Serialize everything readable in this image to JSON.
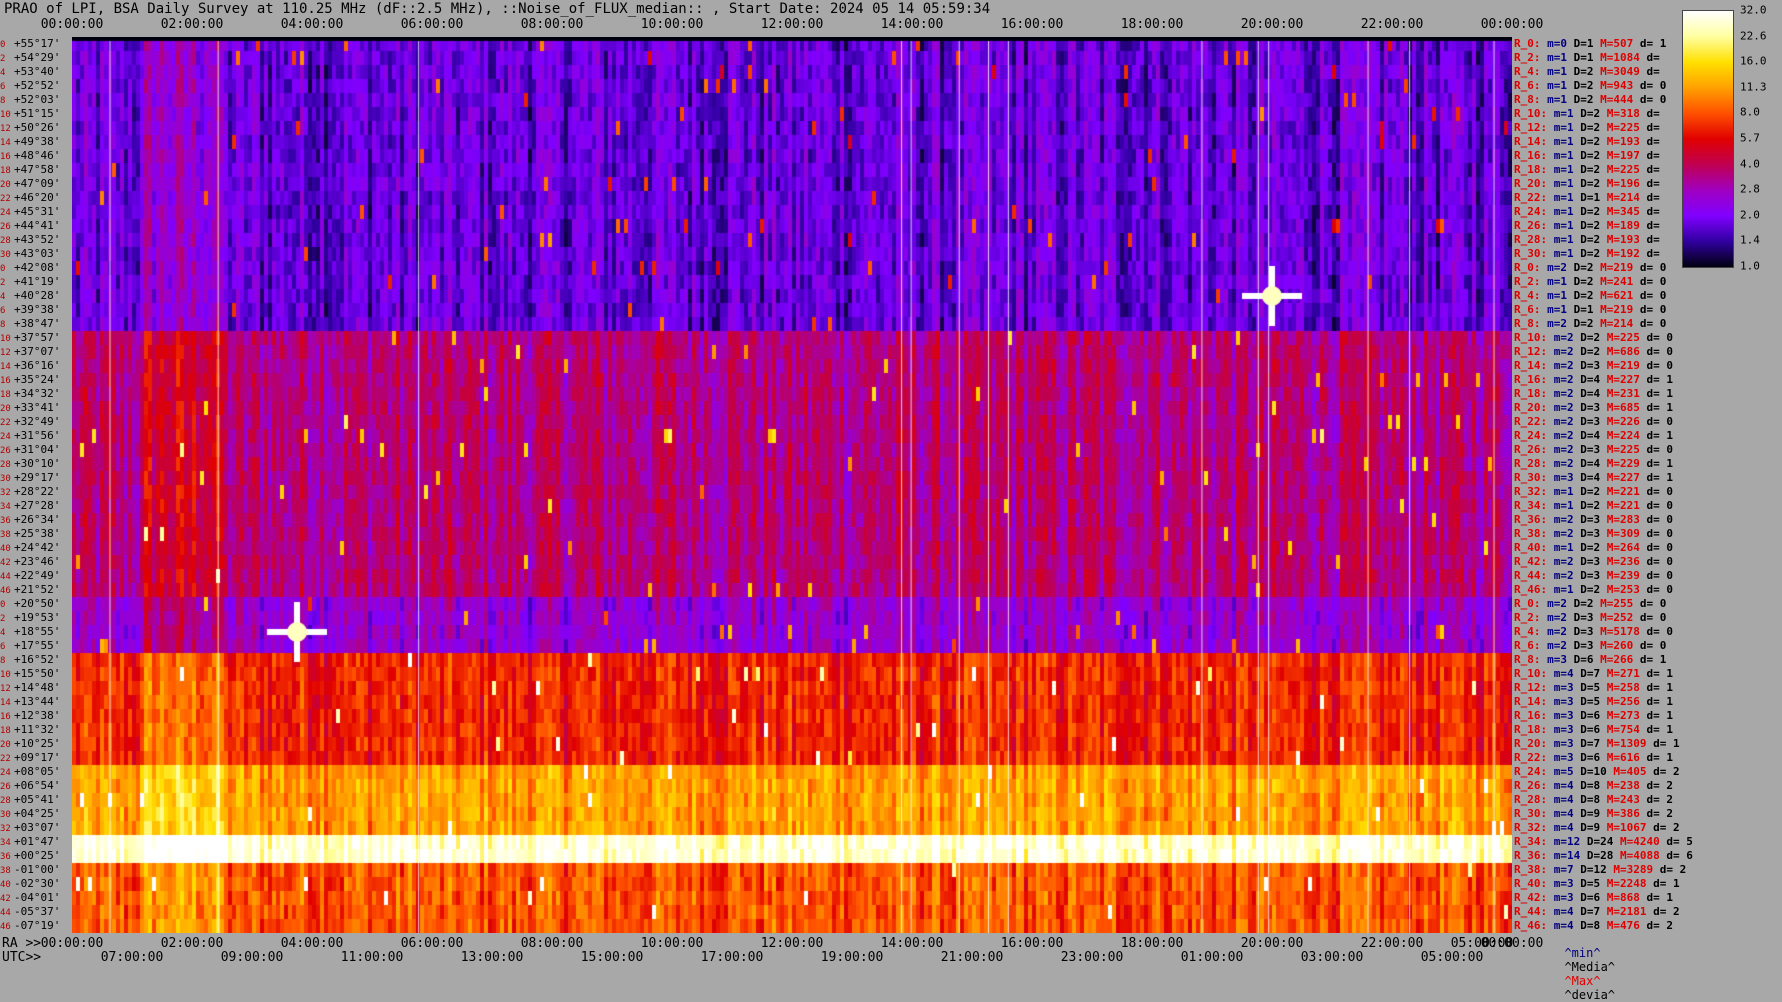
{
  "title": "PRAO of LPI, BSA Daily Survey at 110.25 MHz (dF::2.5 MHz), ::Noise_of_FLUX_median:: , Start Date: 2024 05 14 05:59:34",
  "axis": {
    "top_ticks": [
      "00:00:00",
      "02:00:00",
      "04:00:00",
      "06:00:00",
      "08:00:00",
      "10:00:00",
      "12:00:00",
      "14:00:00",
      "16:00:00",
      "18:00:00",
      "20:00:00",
      "22:00:00",
      "00:00:00"
    ],
    "ra_prefix": "RA >>",
    "ra_ticks": [
      "00:00:00",
      "02:00:00",
      "04:00:00",
      "06:00:00",
      "08:00:00",
      "10:00:00",
      "12:00:00",
      "14:00:00",
      "16:00:00",
      "18:00:00",
      "20:00:00",
      "22:00:00",
      "05:00:00",
      "00:00:00"
    ],
    "utc_prefix": "UTC>>",
    "utc_ticks": [
      "07:00:00",
      "09:00:00",
      "11:00:00",
      "13:00:00",
      "15:00:00",
      "17:00:00",
      "19:00:00",
      "21:00:00",
      "23:00:00",
      "01:00:00",
      "03:00:00",
      "05:00:00"
    ]
  },
  "colorbar": {
    "ticks": [
      "32.0",
      "22.6",
      "16.0",
      "11.3",
      "8.0",
      "5.7",
      "4.0",
      "2.8",
      "2.0",
      "1.4",
      "1.0"
    ],
    "colors": [
      "#ffffff",
      "#ffffa0",
      "#ffe000",
      "#ffa000",
      "#ff5000",
      "#e00000",
      "#c00050",
      "#a000c0",
      "#8000ff",
      "#3000a0",
      "#000010"
    ]
  },
  "legend_key": {
    "min": "^min^",
    "median": "^Media^",
    "max": "^Max^",
    "devia": "^devia^",
    "min_color": "#000080",
    "median_color": "#000000",
    "max_color": "#e00000",
    "devia_color": "#000000"
  },
  "rows": [
    {
      "idx": "0",
      "dec": "+55°17'",
      "r": "R_0:",
      "m": "m=0",
      "D": "D=1",
      "M": "M=507",
      "d": "d= 1"
    },
    {
      "idx": "2",
      "dec": "+54°29'",
      "r": "R_2:",
      "m": "m=1",
      "D": "D=1",
      "M": "M=1084",
      "d": "d="
    },
    {
      "idx": "4",
      "dec": "+53°40'",
      "r": "R_4:",
      "m": "m=1",
      "D": "D=2",
      "M": "M=3049",
      "d": "d="
    },
    {
      "idx": "6",
      "dec": "+52°52'",
      "r": "R_6:",
      "m": "m=1",
      "D": "D=2",
      "M": "M=943",
      "d": "d= 0"
    },
    {
      "idx": "8",
      "dec": "+52°03'",
      "r": "R_8:",
      "m": "m=1",
      "D": "D=2",
      "M": "M=444",
      "d": "d= 0"
    },
    {
      "idx": "10",
      "dec": "+51°15'",
      "r": "R_10:",
      "m": "m=1",
      "D": "D=2",
      "M": "M=318",
      "d": "d="
    },
    {
      "idx": "12",
      "dec": "+50°26'",
      "r": "R_12:",
      "m": "m=1",
      "D": "D=2",
      "M": "M=225",
      "d": "d="
    },
    {
      "idx": "14",
      "dec": "+49°38'",
      "r": "R_14:",
      "m": "m=1",
      "D": "D=2",
      "M": "M=193",
      "d": "d="
    },
    {
      "idx": "16",
      "dec": "+48°46'",
      "r": "R_16:",
      "m": "m=1",
      "D": "D=2",
      "M": "M=197",
      "d": "d="
    },
    {
      "idx": "18",
      "dec": "+47°58'",
      "r": "R_18:",
      "m": "m=1",
      "D": "D=2",
      "M": "M=225",
      "d": "d="
    },
    {
      "idx": "20",
      "dec": "+47°09'",
      "r": "R_20:",
      "m": "m=1",
      "D": "D=2",
      "M": "M=196",
      "d": "d="
    },
    {
      "idx": "22",
      "dec": "+46°20'",
      "r": "R_22:",
      "m": "m=1",
      "D": "D=1",
      "M": "M=214",
      "d": "d="
    },
    {
      "idx": "24",
      "dec": "+45°31'",
      "r": "R_24:",
      "m": "m=1",
      "D": "D=2",
      "M": "M=345",
      "d": "d="
    },
    {
      "idx": "26",
      "dec": "+44°41'",
      "r": "R_26:",
      "m": "m=1",
      "D": "D=2",
      "M": "M=189",
      "d": "d="
    },
    {
      "idx": "28",
      "dec": "+43°52'",
      "r": "R_28:",
      "m": "m=1",
      "D": "D=2",
      "M": "M=193",
      "d": "d="
    },
    {
      "idx": "30",
      "dec": "+43°03'",
      "r": "R_30:",
      "m": "m=1",
      "D": "D=2",
      "M": "M=192",
      "d": "d="
    },
    {
      "idx": "0",
      "dec": "+42°08'",
      "r": "R_0:",
      "m": "m=2",
      "D": "D=2",
      "M": "M=219",
      "d": "d= 0"
    },
    {
      "idx": "2",
      "dec": "+41°19'",
      "r": "R_2:",
      "m": "m=1",
      "D": "D=2",
      "M": "M=241",
      "d": "d= 0"
    },
    {
      "idx": "4",
      "dec": "+40°28'",
      "r": "R_4:",
      "m": "m=1",
      "D": "D=2",
      "M": "M=621",
      "d": "d= 0"
    },
    {
      "idx": "6",
      "dec": "+39°38'",
      "r": "R_6:",
      "m": "m=1",
      "D": "D=1",
      "M": "M=219",
      "d": "d= 0"
    },
    {
      "idx": "8",
      "dec": "+38°47'",
      "r": "R_8:",
      "m": "m=2",
      "D": "D=2",
      "M": "M=214",
      "d": "d= 0"
    },
    {
      "idx": "10",
      "dec": "+37°57'",
      "r": "R_10:",
      "m": "m=2",
      "D": "D=2",
      "M": "M=225",
      "d": "d= 0"
    },
    {
      "idx": "12",
      "dec": "+37°07'",
      "r": "R_12:",
      "m": "m=2",
      "D": "D=2",
      "M": "M=686",
      "d": "d= 0"
    },
    {
      "idx": "14",
      "dec": "+36°16'",
      "r": "R_14:",
      "m": "m=2",
      "D": "D=3",
      "M": "M=219",
      "d": "d= 0"
    },
    {
      "idx": "16",
      "dec": "+35°24'",
      "r": "R_16:",
      "m": "m=2",
      "D": "D=4",
      "M": "M=227",
      "d": "d= 1"
    },
    {
      "idx": "18",
      "dec": "+34°32'",
      "r": "R_18:",
      "m": "m=2",
      "D": "D=4",
      "M": "M=231",
      "d": "d= 1"
    },
    {
      "idx": "20",
      "dec": "+33°41'",
      "r": "R_20:",
      "m": "m=2",
      "D": "D=3",
      "M": "M=685",
      "d": "d= 1"
    },
    {
      "idx": "22",
      "dec": "+32°49'",
      "r": "R_22:",
      "m": "m=2",
      "D": "D=3",
      "M": "M=226",
      "d": "d= 0"
    },
    {
      "idx": "24",
      "dec": "+31°56'",
      "r": "R_24:",
      "m": "m=2",
      "D": "D=4",
      "M": "M=224",
      "d": "d= 1"
    },
    {
      "idx": "26",
      "dec": "+31°04'",
      "r": "R_26:",
      "m": "m=2",
      "D": "D=3",
      "M": "M=225",
      "d": "d= 0"
    },
    {
      "idx": "28",
      "dec": "+30°10'",
      "r": "R_28:",
      "m": "m=2",
      "D": "D=4",
      "M": "M=229",
      "d": "d= 1"
    },
    {
      "idx": "30",
      "dec": "+29°17'",
      "r": "R_30:",
      "m": "m=3",
      "D": "D=4",
      "M": "M=227",
      "d": "d= 1"
    },
    {
      "idx": "32",
      "dec": "+28°22'",
      "r": "R_32:",
      "m": "m=1",
      "D": "D=2",
      "M": "M=221",
      "d": "d= 0"
    },
    {
      "idx": "34",
      "dec": "+27°28'",
      "r": "R_34:",
      "m": "m=1",
      "D": "D=2",
      "M": "M=221",
      "d": "d= 0"
    },
    {
      "idx": "36",
      "dec": "+26°34'",
      "r": "R_36:",
      "m": "m=2",
      "D": "D=3",
      "M": "M=283",
      "d": "d= 0"
    },
    {
      "idx": "38",
      "dec": "+25°38'",
      "r": "R_38:",
      "m": "m=2",
      "D": "D=3",
      "M": "M=309",
      "d": "d= 0"
    },
    {
      "idx": "40",
      "dec": "+24°42'",
      "r": "R_40:",
      "m": "m=1",
      "D": "D=2",
      "M": "M=264",
      "d": "d= 0"
    },
    {
      "idx": "42",
      "dec": "+23°46'",
      "r": "R_42:",
      "m": "m=2",
      "D": "D=3",
      "M": "M=236",
      "d": "d= 0"
    },
    {
      "idx": "44",
      "dec": "+22°49'",
      "r": "R_44:",
      "m": "m=2",
      "D": "D=3",
      "M": "M=239",
      "d": "d= 0"
    },
    {
      "idx": "46",
      "dec": "+21°52'",
      "r": "R_46:",
      "m": "m=1",
      "D": "D=2",
      "M": "M=253",
      "d": "d= 0"
    },
    {
      "idx": "0",
      "dec": "+20°50'",
      "r": "R_0:",
      "m": "m=2",
      "D": "D=2",
      "M": "M=255",
      "d": "d= 0"
    },
    {
      "idx": "2",
      "dec": "+19°53'",
      "r": "R_2:",
      "m": "m=2",
      "D": "D=3",
      "M": "M=252",
      "d": "d= 0"
    },
    {
      "idx": "4",
      "dec": "+18°55'",
      "r": "R_4:",
      "m": "m=2",
      "D": "D=3",
      "M": "M=5178",
      "d": "d= 0"
    },
    {
      "idx": "6",
      "dec": "+17°55'",
      "r": "R_6:",
      "m": "m=2",
      "D": "D=3",
      "M": "M=260",
      "d": "d= 0"
    },
    {
      "idx": "8",
      "dec": "+16°52'",
      "r": "R_8:",
      "m": "m=3",
      "D": "D=6",
      "M": "M=266",
      "d": "d= 1"
    },
    {
      "idx": "10",
      "dec": "+15°50'",
      "r": "R_10:",
      "m": "m=4",
      "D": "D=7",
      "M": "M=271",
      "d": "d= 1"
    },
    {
      "idx": "12",
      "dec": "+14°48'",
      "r": "R_12:",
      "m": "m=3",
      "D": "D=5",
      "M": "M=258",
      "d": "d= 1"
    },
    {
      "idx": "14",
      "dec": "+13°44'",
      "r": "R_14:",
      "m": "m=3",
      "D": "D=5",
      "M": "M=256",
      "d": "d= 1"
    },
    {
      "idx": "16",
      "dec": "+12°38'",
      "r": "R_16:",
      "m": "m=3",
      "D": "D=6",
      "M": "M=273",
      "d": "d= 1"
    },
    {
      "idx": "18",
      "dec": "+11°32'",
      "r": "R_18:",
      "m": "m=3",
      "D": "D=6",
      "M": "M=754",
      "d": "d= 1"
    },
    {
      "idx": "20",
      "dec": "+10°25'",
      "r": "R_20:",
      "m": "m=3",
      "D": "D=7",
      "M": "M=1309",
      "d": "d= 1"
    },
    {
      "idx": "22",
      "dec": "+09°17'",
      "r": "R_22:",
      "m": "m=3",
      "D": "D=6",
      "M": "M=616",
      "d": "d= 1"
    },
    {
      "idx": "24",
      "dec": "+08°05'",
      "r": "R_24:",
      "m": "m=5",
      "D": "D=10",
      "M": "M=405",
      "d": "d= 2"
    },
    {
      "idx": "26",
      "dec": "+06°54'",
      "r": "R_26:",
      "m": "m=4",
      "D": "D=8",
      "M": "M=238",
      "d": "d= 2"
    },
    {
      "idx": "28",
      "dec": "+05°41'",
      "r": "R_28:",
      "m": "m=4",
      "D": "D=8",
      "M": "M=243",
      "d": "d= 2"
    },
    {
      "idx": "30",
      "dec": "+04°25'",
      "r": "R_30:",
      "m": "m=4",
      "D": "D=9",
      "M": "M=386",
      "d": "d= 2"
    },
    {
      "idx": "32",
      "dec": "+03°07'",
      "r": "R_32:",
      "m": "m=4",
      "D": "D=9",
      "M": "M=1067",
      "d": "d= 2"
    },
    {
      "idx": "34",
      "dec": "+01°47'",
      "r": "R_34:",
      "m": "m=12",
      "D": "D=24",
      "M": "M=4240",
      "d": "d= 5"
    },
    {
      "idx": "36",
      "dec": "+00°25'",
      "r": "R_36:",
      "m": "m=14",
      "D": "D=28",
      "M": "M=4088",
      "d": "d= 6"
    },
    {
      "idx": "38",
      "dec": "-01°00'",
      "r": "R_38:",
      "m": "m=7",
      "D": "D=12",
      "M": "M=3289",
      "d": "d= 2"
    },
    {
      "idx": "40",
      "dec": "-02°30'",
      "r": "R_40:",
      "m": "m=3",
      "D": "D=5",
      "M": "M=2248",
      "d": "d= 1"
    },
    {
      "idx": "42",
      "dec": "-04°01'",
      "r": "R_42:",
      "m": "m=3",
      "D": "D=6",
      "M": "M=868",
      "d": "d= 1"
    },
    {
      "idx": "44",
      "dec": "-05°37'",
      "r": "R_44:",
      "m": "m=4",
      "D": "D=7",
      "M": "M=2181",
      "d": "d= 2"
    },
    {
      "idx": "46",
      "dec": "-07°19'",
      "r": "R_46:",
      "m": "m=4",
      "D": "D=8",
      "M": "M=476",
      "d": "d= 2"
    }
  ],
  "chart_data": {
    "type": "heatmap",
    "title": "PRAO of LPI, BSA Daily Survey at 110.25 MHz (dF::2.5 MHz), ::Noise_of_FLUX_median:: , Start Date: 2024 05 14 05:59:34",
    "x_axis_top": "RA",
    "xlim": [
      "00:00:00",
      "24:00:00"
    ],
    "ylim": [
      "+55°17'",
      "-07°19'"
    ],
    "colorbar_range": [
      1.0,
      32.0
    ],
    "colorbar_scale": "log",
    "bright_sources": [
      {
        "ra": "03:45",
        "dec": "+18°55'",
        "level": 32.0
      },
      {
        "ra": "20:00",
        "dec": "+40°28'",
        "level": 32.0
      }
    ],
    "band_levels": [
      {
        "dec_from": "+55°17'",
        "dec_to": "+38°47'",
        "typical": 1.8
      },
      {
        "dec_from": "+37°57'",
        "dec_to": "+21°52'",
        "typical": 3.5
      },
      {
        "dec_from": "+20°50'",
        "dec_to": "+17°55'",
        "typical": 2.5
      },
      {
        "dec_from": "+16°52'",
        "dec_to": "+09°17'",
        "typical": 6.5
      },
      {
        "dec_from": "+08°05'",
        "dec_to": "+03°07'",
        "typical": 11.3
      },
      {
        "dec_from": "+01°47'",
        "dec_to": "+00°25'",
        "typical": 28.0
      },
      {
        "dec_from": "-01°00'",
        "dec_to": "-07°19'",
        "typical": 8.0
      }
    ]
  }
}
